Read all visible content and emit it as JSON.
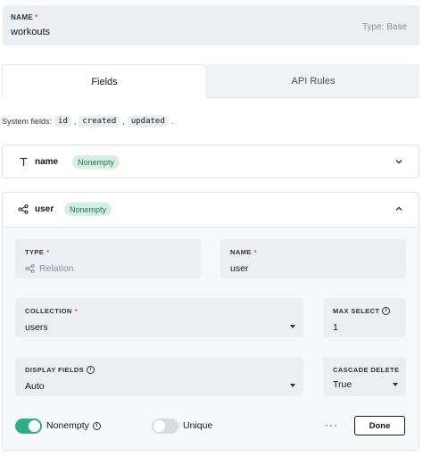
{
  "collection": {
    "name_label": "NAME",
    "name_required": "*",
    "name_value": "workouts",
    "type_text": "Type: Base"
  },
  "tabs": [
    {
      "label": "Fields",
      "active": true
    },
    {
      "label": "API Rules",
      "active": false
    }
  ],
  "system_fields": {
    "prefix": "System fields:",
    "items": [
      "id",
      "created",
      "updated"
    ],
    "separator": ",",
    "suffix": "."
  },
  "fields": [
    {
      "name": "name",
      "icon": "text-icon",
      "badge": "Nonempty",
      "expanded": false
    },
    {
      "name": "user",
      "icon": "relation-icon",
      "badge": "Nonempty",
      "expanded": true,
      "form": {
        "type_label": "TYPE",
        "type_value": "Relation",
        "name_label": "NAME",
        "name_value": "user",
        "required_mark": "*",
        "collection_label": "COLLECTION",
        "collection_value": "users",
        "max_select_label": "MAX SELECT",
        "max_select_value": "1",
        "display_fields_label": "DISPLAY FIELDS",
        "display_fields_value": "Auto",
        "cascade_delete_label": "CASCADE DELETE",
        "cascade_delete_value": "True",
        "nonempty_label": "Nonempty",
        "nonempty_on": true,
        "unique_label": "Unique",
        "unique_on": false,
        "more_label": "···",
        "done_label": "Done"
      }
    }
  ],
  "colors": {
    "accent_green": "#32ad84",
    "badge_bg": "#d6efe3",
    "badge_text": "#1d7a50",
    "required": "#e34562",
    "field_bg": "#ebeff2"
  }
}
